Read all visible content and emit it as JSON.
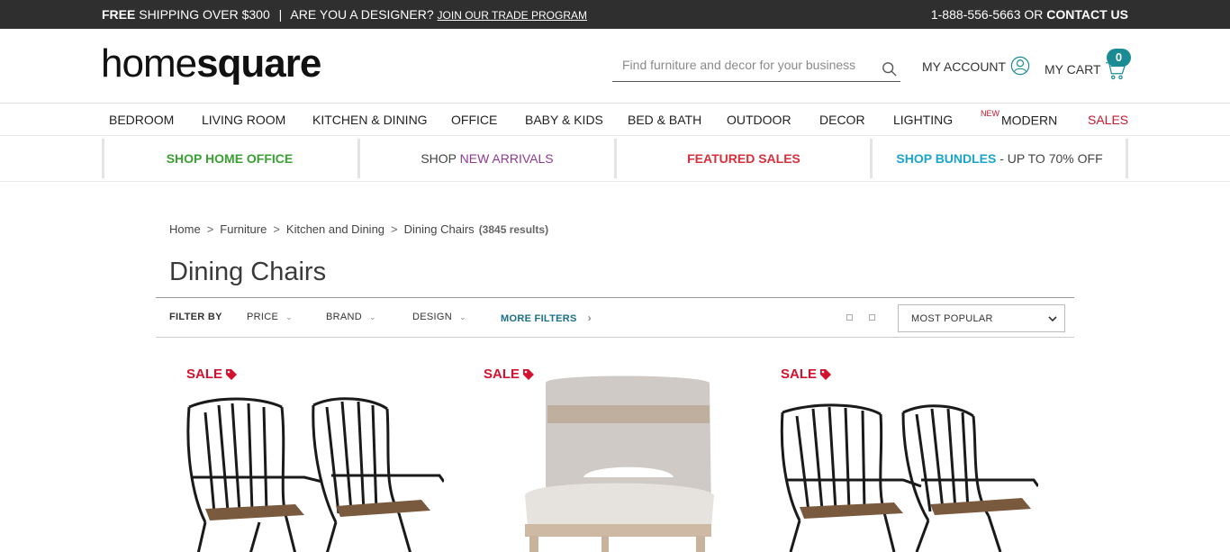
{
  "topbar": {
    "free": "FREE",
    "shipping": "SHIPPING OVER $300",
    "separator": "|",
    "designer": "ARE YOU A DESIGNER?",
    "trade_link": "JOIN OUR TRADE PROGRAM",
    "phone": "1-888-556-5663 OR",
    "contact": "CONTACT US"
  },
  "header": {
    "logo_light": "home",
    "logo_bold": "square",
    "search_placeholder": "Find furniture and decor for your business",
    "account_label": "MY ACCOUNT",
    "cart_label": "MY CART",
    "cart_count": "0"
  },
  "nav": {
    "items": [
      {
        "label": "BEDROOM"
      },
      {
        "label": "LIVING ROOM"
      },
      {
        "label": "KITCHEN & DINING"
      },
      {
        "label": "OFFICE"
      },
      {
        "label": "BABY & KIDS"
      },
      {
        "label": "BED & BATH"
      },
      {
        "label": "OUTDOOR"
      },
      {
        "label": "DECOR"
      },
      {
        "label": "LIGHTING"
      }
    ],
    "new_badge": "NEW",
    "modern": "MODERN",
    "sales": "SALES"
  },
  "promo": {
    "home_office": "SHOP HOME OFFICE",
    "new_arrivals_prefix": "SHOP",
    "new_arrivals": "NEW ARRIVALS",
    "featured_sales": "FEATURED SALES",
    "bundles": "SHOP BUNDLES",
    "bundles_suffix": "- UP TO 70% OFF"
  },
  "breadcrumb": {
    "items": [
      "Home",
      "Furniture",
      "Kitchen and Dining",
      "Dining Chairs"
    ],
    "separator": ">",
    "results": "(3845 results)"
  },
  "page_title": "Dining Chairs",
  "filters": {
    "filter_by": "FILTER BY",
    "price": "PRICE",
    "brand": "BRAND",
    "design": "DESIGN",
    "more_filters": "MORE FILTERS",
    "sort_value": "MOST POPULAR"
  },
  "products": [
    {
      "sale_label": "SALE"
    },
    {
      "sale_label": "SALE"
    },
    {
      "sale_label": "SALE"
    }
  ],
  "colors": {
    "topbar_bg": "#2f2f2f",
    "sale_red": "#d3122f",
    "cart_badge": "#1a8b95",
    "promo_green": "#3aa033",
    "promo_purple": "#8e3a92",
    "promo_red": "#d8303b",
    "promo_teal": "#1aa5c9",
    "link_teal": "#1a6f89"
  }
}
